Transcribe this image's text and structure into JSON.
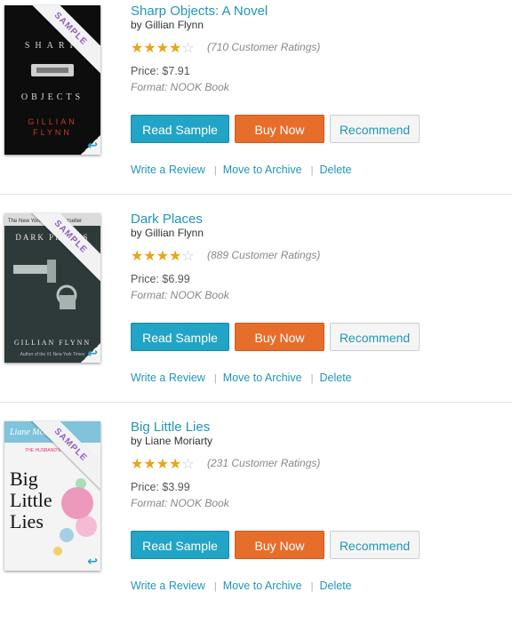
{
  "books": [
    {
      "title": "Sharp Objects: A Novel",
      "author": "by Gillian Flynn",
      "rating_stars": 3.5,
      "ratings_text": "(710 Customer Ratings)",
      "price": "Price: $7.91",
      "format": "Format: NOOK Book",
      "cover": {
        "bg": "#0d0d0d",
        "accent": "#c83a2c",
        "title_text": "SHARP OBJECTS",
        "author_text": "GILLIAN FLYNN"
      }
    },
    {
      "title": "Dark Places",
      "author": "by Gillian Flynn",
      "rating_stars": 3.5,
      "ratings_text": "(889 Customer Ratings)",
      "price": "Price: $6.99",
      "format": "Format: NOOK Book",
      "cover": {
        "bg": "#33403f",
        "accent": "#e0e0e0",
        "title_text": "DARK PLACES",
        "author_text": "GILLIAN FLYNN"
      }
    },
    {
      "title": "Big Little Lies",
      "author": "by Liane Moriarty",
      "rating_stars": 3.5,
      "ratings_text": "(231 Customer Ratings)",
      "price": "Price: $3.99",
      "format": "Format: NOOK Book",
      "cover": {
        "bg": "#f2f2f2",
        "accent": "#d9327a",
        "title_text": "Big Little Lies",
        "author_text": "Liane Moriarty"
      }
    }
  ],
  "labels": {
    "sample": "SAMPLE",
    "read_sample": "Read Sample",
    "buy_now": "Buy Now",
    "recommend": "Recommend",
    "write_review": "Write a Review",
    "move_archive": "Move to Archive",
    "delete": "Delete",
    "separator": "|"
  },
  "colors": {
    "link": "#2196b5",
    "read_sample_btn": "#22a4c6",
    "buy_now_btn": "#e66e2a",
    "star": "#e8a317"
  }
}
